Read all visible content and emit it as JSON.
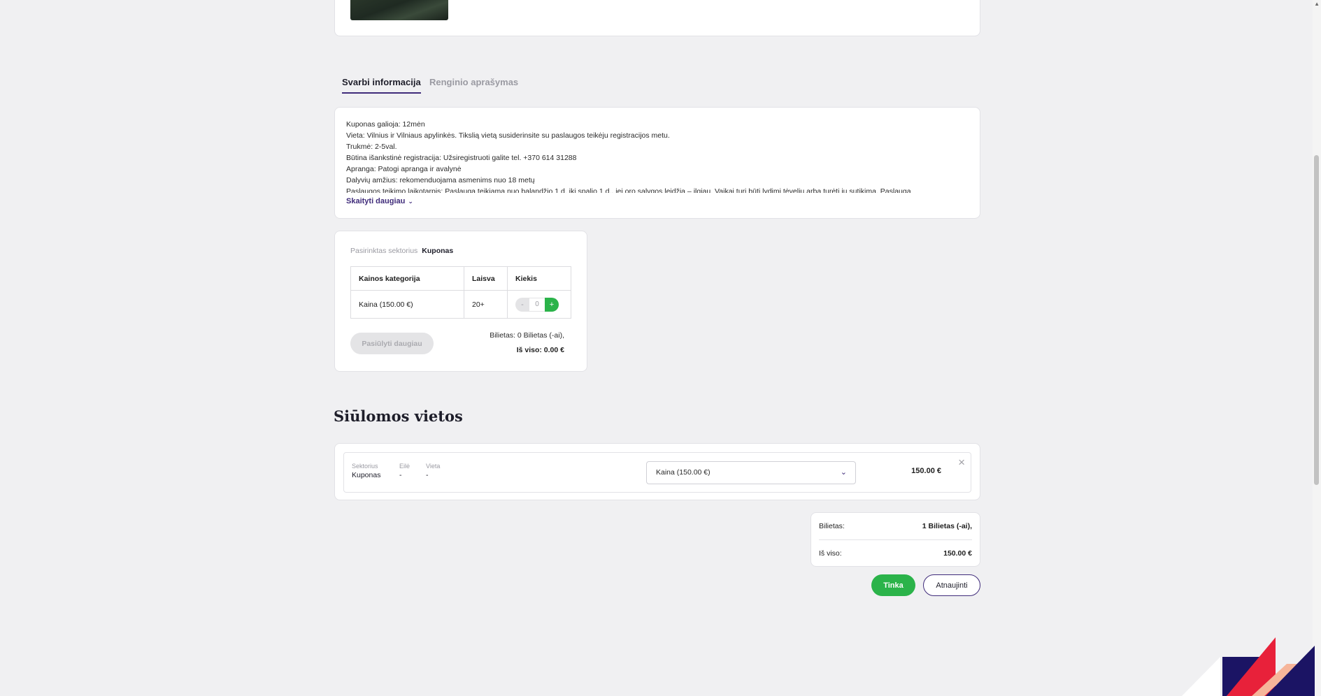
{
  "tabs": [
    {
      "label": "Svarbi informacija"
    },
    {
      "label": "Renginio aprašymas"
    }
  ],
  "info": {
    "lines": [
      "Kuponas galioja: 12mėn",
      "Vieta:  Vilnius ir Vilniaus apylinkės. Tikslią vietą susiderinsite su paslaugos teikėju registracijos metu.",
      "Trukmė: 2-5val.",
      "Būtina išankstinė registracija: Užsiregistruoti galite tel. +370 614 31288",
      "Apranga: Patogi apranga ir avalynė",
      "Dalyvių amžius: rekomenduojama asmenims nuo 18 metų",
      "Paslaugos teikimo laikotarpis: Paslauga teikiama nuo balandžio 1 d. iki spalio 1 d., jei oro sąlygos leidžia – ilgiau. Vaikai turi būti lydimi tėvelių arba turėti jų sutikimą. Paslauga"
    ],
    "read_more": "Skaityti daugiau"
  },
  "ticket": {
    "sector_label": "Pasirinktas sektorius",
    "sector_value": "Kuponas",
    "headers": [
      "Kainos kategorija",
      "Laisva",
      "Kiekis"
    ],
    "rows": [
      {
        "category": "Kaina (150.00 €)",
        "available": "20+",
        "minus": "-",
        "qty": "0",
        "plus": "+"
      }
    ],
    "offer_more": "Pasiūlyti daugiau",
    "summary_tickets": "Bilietas: 0 Bilietas (-ai),",
    "summary_total": "Iš viso: 0.00 €"
  },
  "offered": {
    "title": "Siūlomos vietos",
    "fields": [
      {
        "label": "Sektorius",
        "value": "Kuponas"
      },
      {
        "label": "Eilė",
        "value": "-"
      },
      {
        "label": "Vieta",
        "value": "-"
      }
    ],
    "price_option": "Kaina (150.00 €)",
    "price": "150.00 €",
    "remove_icon": "×"
  },
  "totals": {
    "tickets_label": "Bilietas:",
    "tickets_value": "1 Bilietas (-ai),",
    "total_label": "Iš viso:",
    "total_value": "150.00 €"
  },
  "actions": {
    "ok": "Tinka",
    "refresh": "Atnaujinti"
  },
  "colors": {
    "accent": "#3f2b7a",
    "success": "#2bb34a",
    "background": "#f0f0f2"
  },
  "icons": {
    "chevron": "chevron-down-icon",
    "close": "close-icon"
  }
}
